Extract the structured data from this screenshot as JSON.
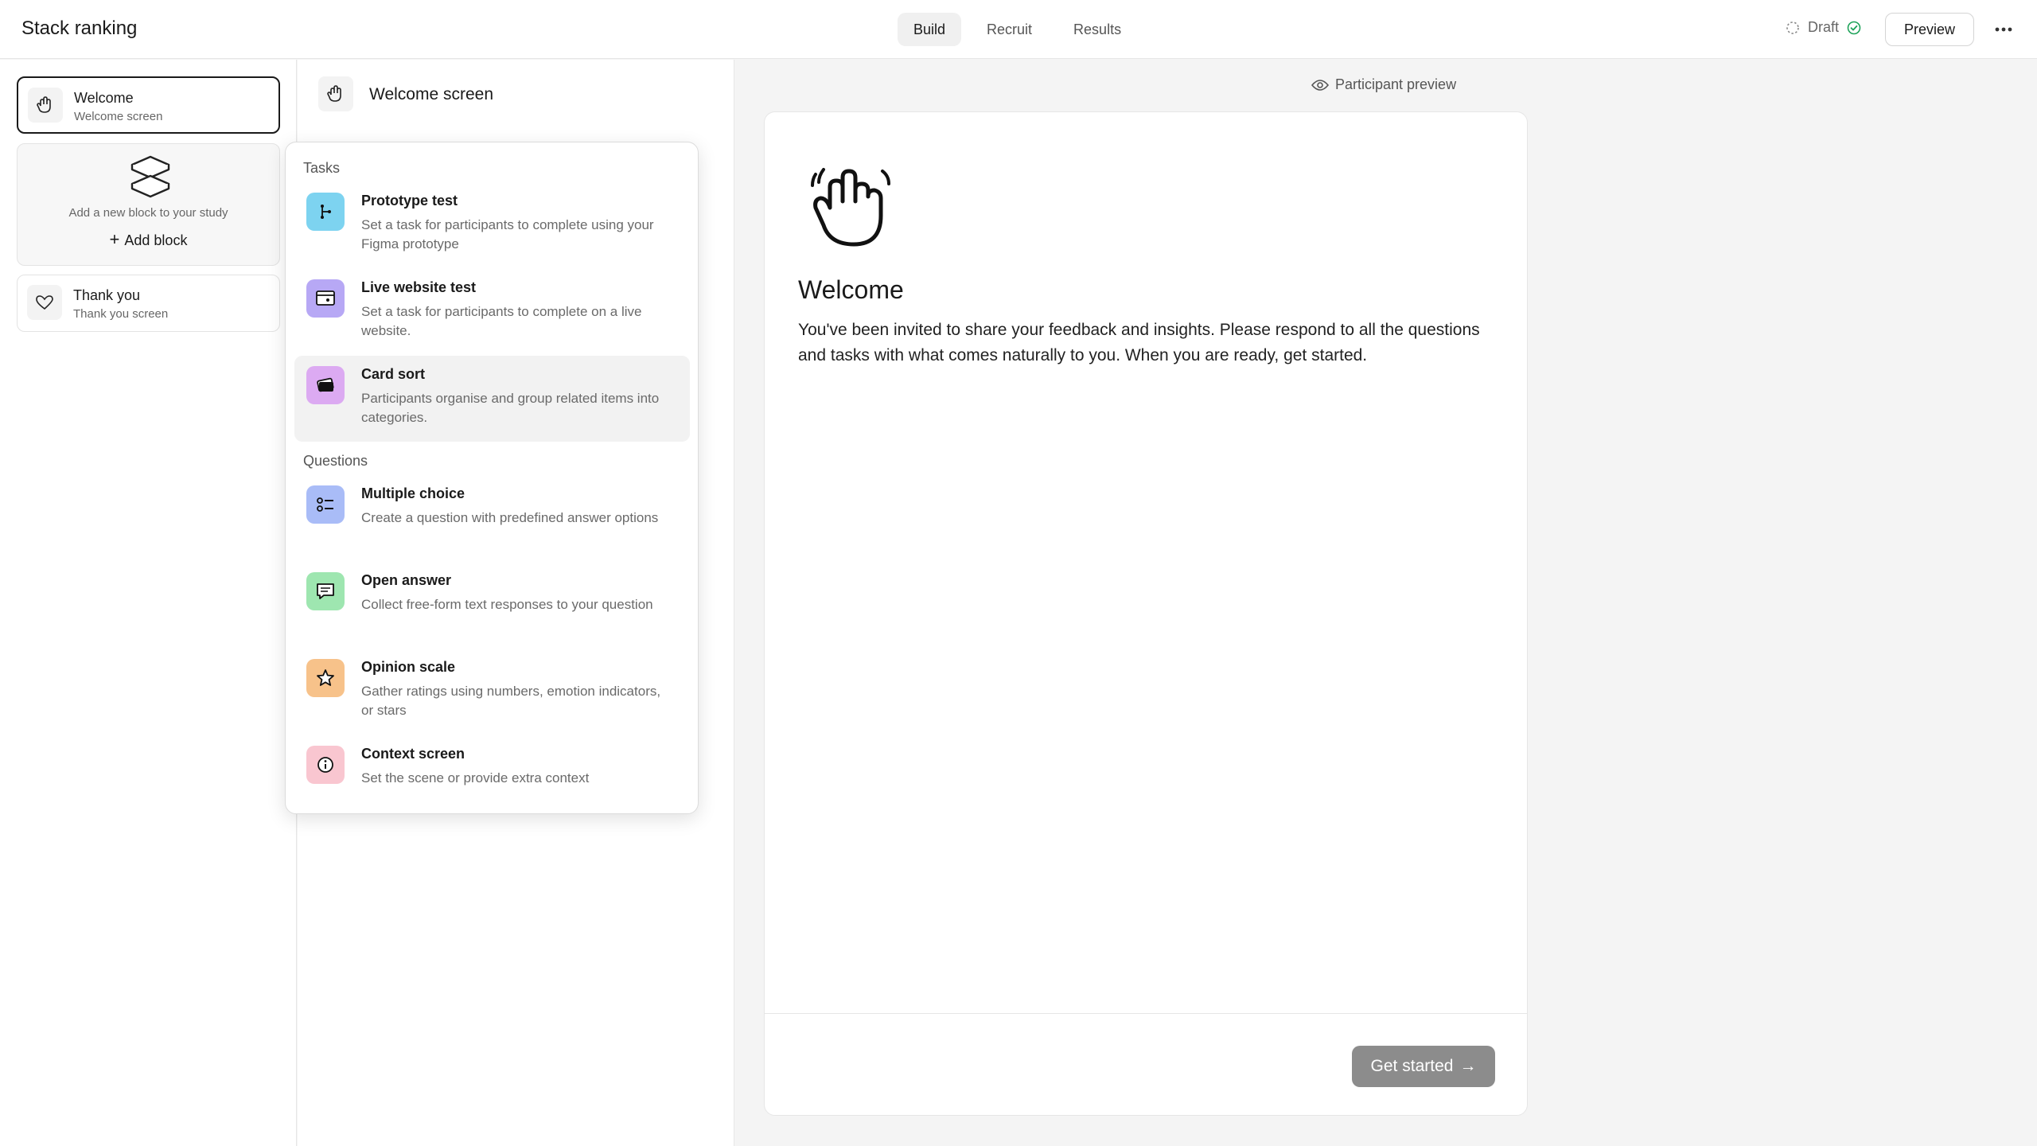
{
  "app": {
    "title": "Stack ranking"
  },
  "header": {
    "tabs": [
      {
        "label": "Build",
        "active": true
      },
      {
        "label": "Recruit",
        "active": false
      },
      {
        "label": "Results",
        "active": false
      }
    ],
    "status": "Draft",
    "preview_label": "Preview",
    "more_icon": "more-horizontal-icon"
  },
  "sidebar": {
    "blocks": [
      {
        "title": "Welcome",
        "subtitle": "Welcome screen",
        "icon": "waving-hand-icon",
        "selected": true
      },
      {
        "title": "Thank you",
        "subtitle": "Thank you screen",
        "icon": "heart-hand-icon",
        "selected": false
      }
    ],
    "add_block": {
      "hint": "Add a new block to your study",
      "label": "Add block"
    }
  },
  "editor": {
    "title": "Welcome screen"
  },
  "menu": {
    "tasks_heading": "Tasks",
    "questions_heading": "Questions",
    "tasks": [
      {
        "title": "Prototype test",
        "desc": "Set a task for participants to complete using your Figma prototype",
        "icon": "prototype-icon",
        "color": "#7dd3f0"
      },
      {
        "title": "Live website test",
        "desc": "Set a task for participants to complete on a live website.",
        "icon": "browser-icon",
        "color": "#b7a8f5"
      },
      {
        "title": "Card sort",
        "desc": "Participants organise and group related items into categories.",
        "icon": "cards-icon",
        "color": "#dcaaf2"
      }
    ],
    "questions": [
      {
        "title": "Multiple choice",
        "desc": "Create a question with predefined answer options",
        "icon": "list-icon",
        "color": "#a9bcf7"
      },
      {
        "title": "Open answer",
        "desc": "Collect free-form text responses to your question",
        "icon": "chat-icon",
        "color": "#9ee6b0"
      },
      {
        "title": "Opinion scale",
        "desc": "Gather ratings using numbers, emotion indicators, or stars",
        "icon": "star-icon",
        "color": "#f7c28a"
      },
      {
        "title": "Context screen",
        "desc": "Set the scene or provide extra context",
        "icon": "info-icon",
        "color": "#f9c6d0"
      }
    ]
  },
  "preview": {
    "label": "Participant preview",
    "title": "Welcome",
    "body": "You've been invited to share your feedback and insights. Please respond to all the questions and tasks with what comes naturally to you. When you are ready, get started.",
    "cta": "Get started"
  }
}
